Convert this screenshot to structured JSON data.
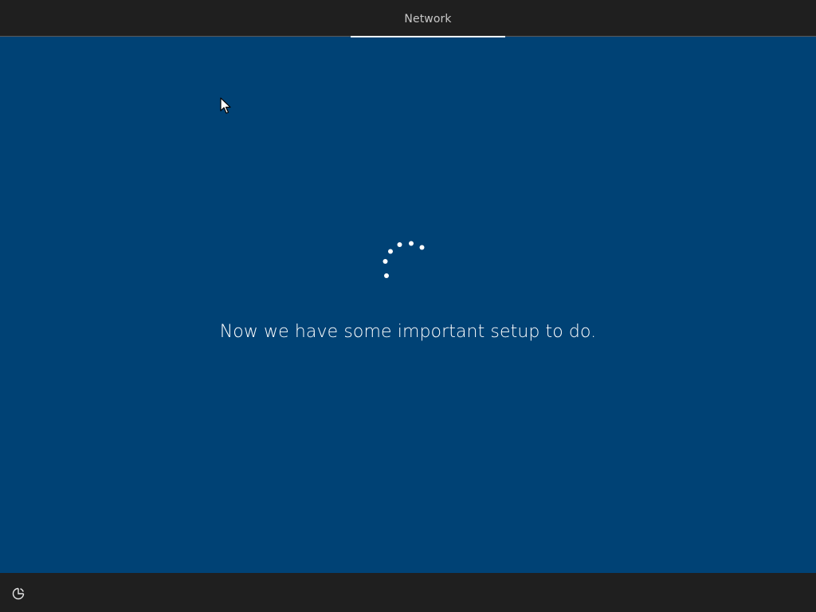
{
  "header": {
    "active_tab": "Network"
  },
  "main": {
    "status_message": "Now we have some important setup to do."
  },
  "footer": {
    "accessibility_icon": "ease-of-access-icon"
  },
  "colors": {
    "background": "#004275",
    "bars": "#1f1f1f",
    "text": "#ffffff"
  }
}
